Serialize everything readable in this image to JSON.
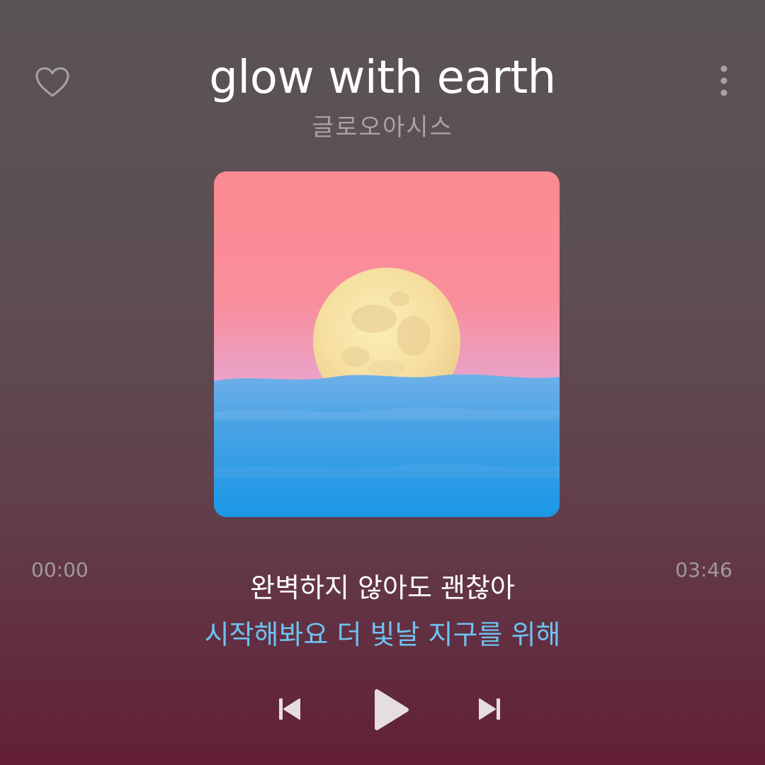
{
  "track": {
    "title": "glow with earth",
    "artist": "글로오아시스"
  },
  "player": {
    "elapsed": "00:00",
    "duration": "03:46",
    "progress": 0,
    "favorited": false
  },
  "lyrics": {
    "current": "완벽하지 않아도 괜찮아",
    "next": "시작해봐요 더 빛날 지구를 위해"
  },
  "icons": {
    "favorite": "heart-outline-icon",
    "more": "more-vertical-icon",
    "previous": "skip-previous-icon",
    "play": "play-icon",
    "next": "skip-next-icon"
  },
  "colors": {
    "background_top": "#5a5355",
    "background_bottom": "#631f38",
    "title": "#ffffff",
    "artist": "#a9a3a5",
    "lyric_current": "#ffffff",
    "lyric_next": "#6ec2f1",
    "controls": "#e6dde1"
  }
}
